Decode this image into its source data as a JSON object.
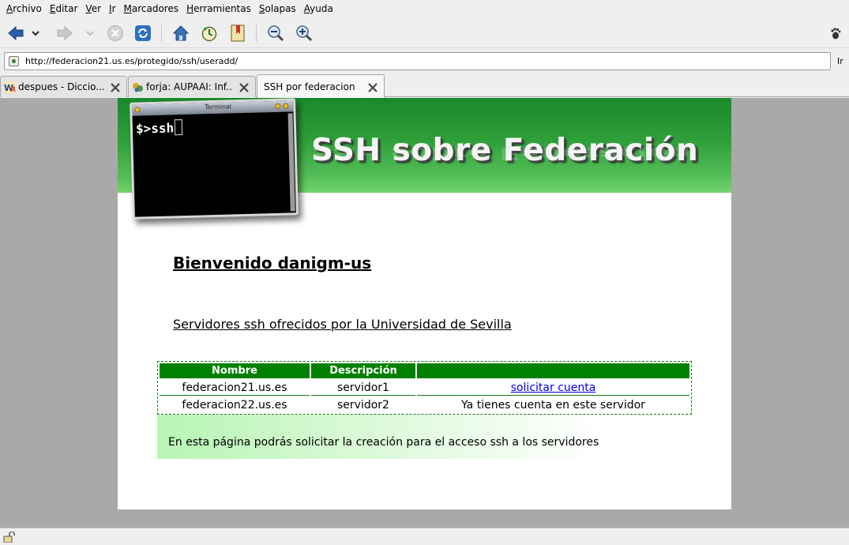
{
  "menu": {
    "items": [
      {
        "u": "A",
        "rest": "rchivo"
      },
      {
        "u": "E",
        "rest": "ditar"
      },
      {
        "u": "V",
        "rest": "er"
      },
      {
        "u": "I",
        "rest": "r"
      },
      {
        "u": "M",
        "rest": "arcadores"
      },
      {
        "u": "H",
        "rest": "erramientas"
      },
      {
        "u": "S",
        "rest": "olapas"
      },
      {
        "u": "A",
        "rest": "yuda"
      }
    ]
  },
  "location": {
    "url": "http://federacion21.us.es/protegido/ssh/useradd/",
    "go_label": "Ir"
  },
  "tabs": [
    {
      "label": "despues - Diccio...",
      "icon": "wr-favicon"
    },
    {
      "label": "forja: AUPAAI: Inf...",
      "icon": "forja-favicon"
    },
    {
      "label": "SSH por federacion",
      "icon": "",
      "active": true
    }
  ],
  "banner": {
    "title": "SSH sobre Federación",
    "terminal_title": "Terminal",
    "terminal_prompt": "$>ssh"
  },
  "page": {
    "welcome": "Bienvenido danigm-us",
    "servers_heading": "Servidores ssh ofrecidos por la Universidad de Sevilla",
    "table": {
      "headers": [
        "Nombre",
        "Descripción",
        ""
      ],
      "rows": [
        {
          "name": "federacion21.us.es",
          "desc": "servidor1",
          "action": "solicitar cuenta",
          "action_is_link": true
        },
        {
          "name": "federacion22.us.es",
          "desc": "servidor2",
          "action": "Ya tienes cuenta en este servidor",
          "action_is_link": false
        }
      ]
    },
    "info": "En esta página podrás solicitar la creación para el acceso ssh a los servidores"
  },
  "colors": {
    "banner_green": "#19892a",
    "table_header": "#008000",
    "link": "#0000ee",
    "nav_blue": "#2a5ea8"
  }
}
